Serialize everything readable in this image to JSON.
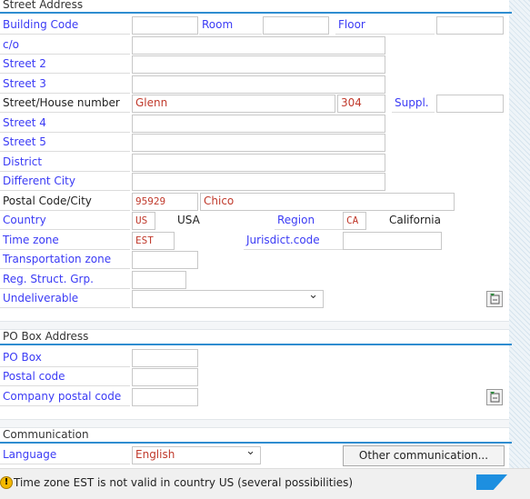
{
  "street_address": {
    "title": "Street Address",
    "building_code": {
      "label": "Building Code",
      "value": ""
    },
    "room": {
      "label": "Room",
      "value": ""
    },
    "floor": {
      "label": "Floor",
      "value": ""
    },
    "co": {
      "label": "c/o",
      "value": ""
    },
    "street2": {
      "label": "Street 2",
      "value": ""
    },
    "street3": {
      "label": "Street 3",
      "value": ""
    },
    "street": {
      "label": "Street/House number",
      "value": "Glenn",
      "house": "304"
    },
    "suppl": {
      "label": "Suppl.",
      "value": ""
    },
    "street4": {
      "label": "Street 4",
      "value": ""
    },
    "street5": {
      "label": "Street 5",
      "value": ""
    },
    "district": {
      "label": "District",
      "value": ""
    },
    "different_city": {
      "label": "Different City",
      "value": ""
    },
    "postal_city": {
      "label": "Postal Code/City",
      "postal": "95929",
      "city": "Chico"
    },
    "country": {
      "label": "Country",
      "value": "US",
      "name": "USA"
    },
    "region": {
      "label": "Region",
      "value": "CA",
      "name": "California"
    },
    "time_zone": {
      "label": "Time zone",
      "value": "EST"
    },
    "jurisdict": {
      "label": "Jurisdict.code",
      "value": ""
    },
    "transport_zone": {
      "label": "Transportation zone",
      "value": ""
    },
    "reg_struct": {
      "label": "Reg. Struct. Grp.",
      "value": ""
    },
    "undeliverable": {
      "label": "Undeliverable",
      "value": ""
    }
  },
  "po_box": {
    "title": "PO Box Address",
    "po_box": {
      "label": "PO Box",
      "value": ""
    },
    "postal_code": {
      "label": "Postal code",
      "value": ""
    },
    "company_postal_code": {
      "label": "Company postal code",
      "value": ""
    }
  },
  "communication": {
    "title": "Communication",
    "language": {
      "label": "Language",
      "value": "English"
    },
    "other_button": "Other communication..."
  },
  "status": {
    "type": "warning",
    "message": "Time zone EST is not valid in country US (several possibilities)",
    "logo": "SAP"
  },
  "colors": {
    "label_blue": "#3b3bf5",
    "value_red": "#c0392b",
    "accent": "#2f8dd0",
    "logo": "#1d8fe0"
  }
}
